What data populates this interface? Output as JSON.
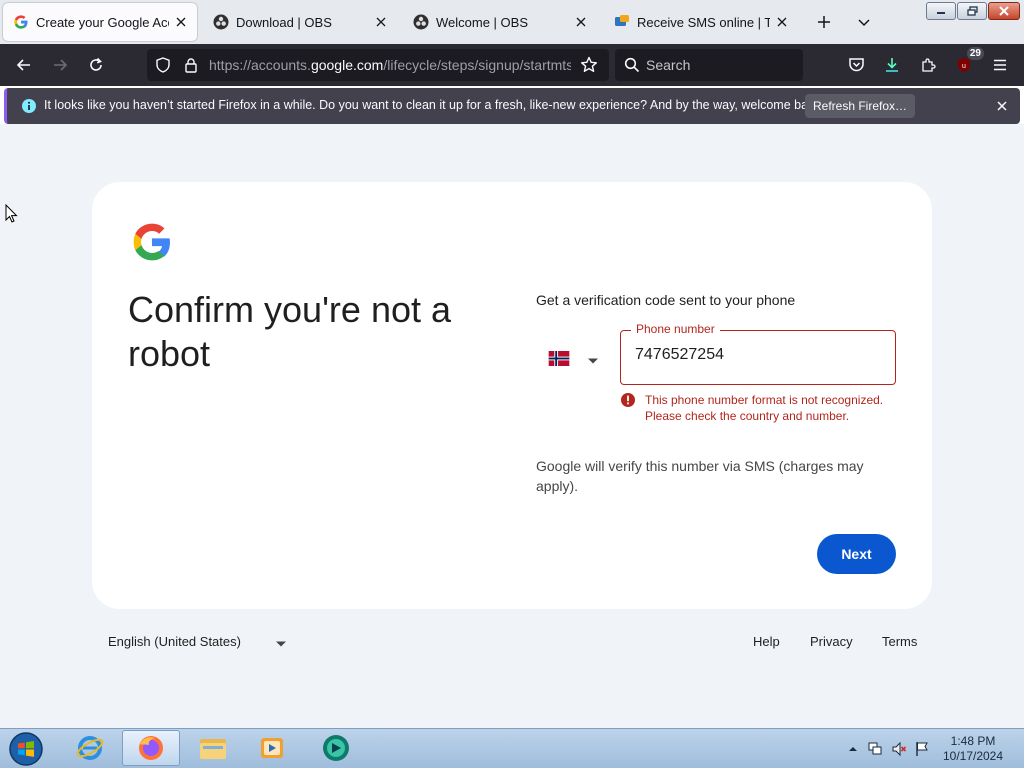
{
  "browser": {
    "tabs": [
      {
        "title": "Create your Google Account",
        "favicon": "google-g-icon",
        "active": true
      },
      {
        "title": "Download | OBS",
        "favicon": "obs-icon",
        "active": false
      },
      {
        "title": "Welcome | OBS",
        "favicon": "obs-icon",
        "active": false
      },
      {
        "title": "Receive SMS online | Temp",
        "favicon": "sms-site-icon",
        "active": false
      }
    ],
    "url_prefix": "https://accounts.",
    "url_host": "google.com",
    "url_path": "/lifecycle/steps/signup/startmtsmsidv",
    "search_placeholder": "Search",
    "extension_badge": "29"
  },
  "notification": {
    "message": "It looks like you haven’t started Firefox in a while. Do you want to clean it up for a fresh, like-new experience? And by the way, welcome back!",
    "button_label": "Refresh Firefox…"
  },
  "signup": {
    "headline": "Confirm you're not a robot",
    "subtitle": "Get a verification code sent to your phone",
    "country": "Norway",
    "phone_label": "Phone number",
    "phone_value": "7476527254",
    "error_text": "This phone number format is not recognized. Please check the country and number.",
    "verify_note": "Google will verify this number via SMS (charges may apply).",
    "next_label": "Next"
  },
  "footer": {
    "language": "English (United States)",
    "links": [
      "Help",
      "Privacy",
      "Terms"
    ]
  },
  "taskbar": {
    "time": "1:48 PM",
    "date": "10/17/2024"
  },
  "colors": {
    "accent": "#0b57d0",
    "error": "#b3261e",
    "page_bg": "#f0f4f9",
    "firefox_toolbar": "#2b2a33"
  }
}
